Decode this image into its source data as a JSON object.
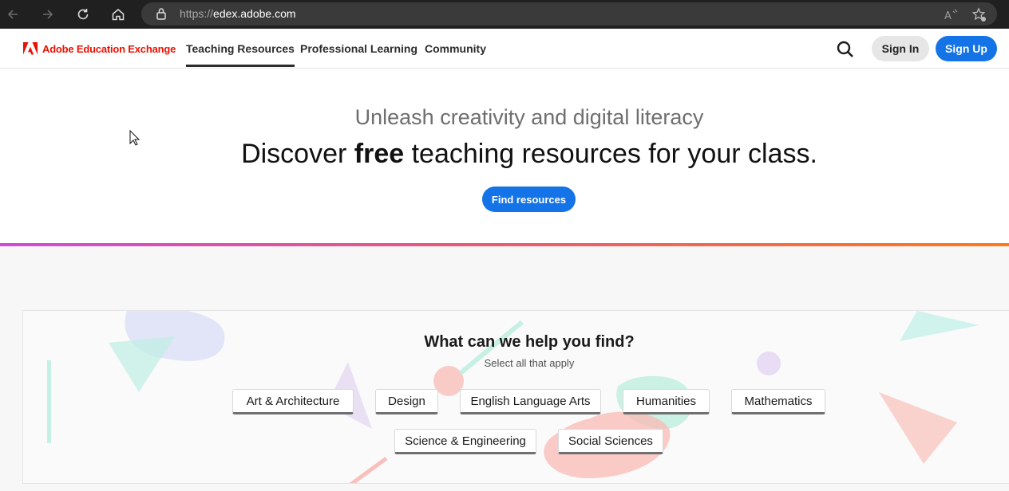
{
  "browser": {
    "url_scheme": "https://",
    "url_host": "edex.adobe.com",
    "icons": [
      "back-icon",
      "forward-icon",
      "refresh-icon",
      "home-icon",
      "lock-icon",
      "read-aloud-icon",
      "favorites-icon"
    ]
  },
  "header": {
    "brand": "Adobe Education Exchange",
    "nav": [
      {
        "label": "Teaching Resources",
        "active": true
      },
      {
        "label": "Professional Learning",
        "active": false
      },
      {
        "label": "Community",
        "active": false
      }
    ],
    "sign_in": "Sign In",
    "sign_up": "Sign Up",
    "colors": {
      "brand": "#eb1000",
      "primary": "#1473e6"
    }
  },
  "hero": {
    "subtitle": "Unleash creativity and digital literacy",
    "title_pre": "Discover ",
    "title_bold": "free",
    "title_post": " teaching resources for your class.",
    "cta": "Find resources"
  },
  "finder": {
    "title": "What can we help you find?",
    "subtitle": "Select all that apply",
    "subjects": [
      "Art & Architecture",
      "Design",
      "English Language Arts",
      "Humanities",
      "Mathematics",
      "Science & Engineering",
      "Social Sciences"
    ]
  }
}
